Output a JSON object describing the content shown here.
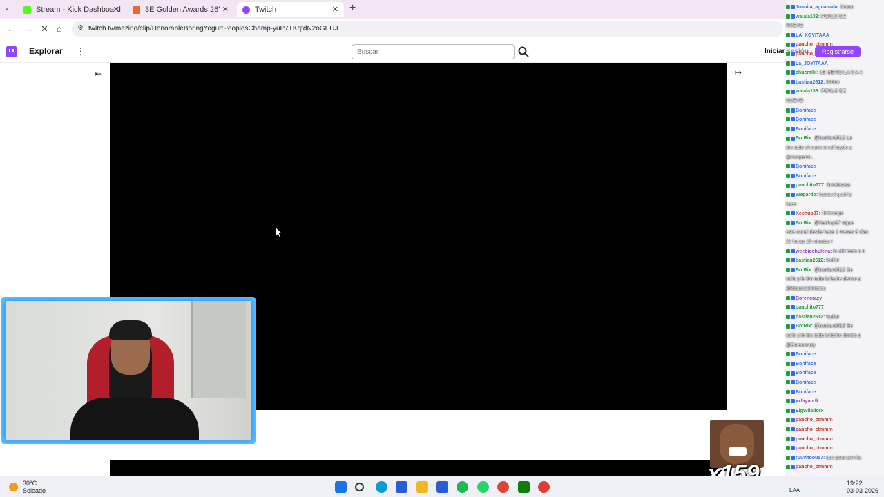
{
  "browser": {
    "tabs": [
      {
        "title": "Stream - Kick Dashboard",
        "favicon_color": "#53fc18",
        "active": false
      },
      {
        "title": "3E Golden Awards 26'",
        "favicon_color": "#f26522",
        "active": false
      },
      {
        "title": "Twitch",
        "favicon_color": "#9146ff",
        "active": true
      }
    ],
    "url": "twitch.tv/mazino/clip/HonorableBoringYogurtPeoplesChamp-yuP7TKqtdN2oGEUJ"
  },
  "twitch": {
    "explore_label": "Explorar",
    "search_placeholder": "Buscar",
    "login_label": "Iniciar sesión",
    "register_label": "Registrarse"
  },
  "chat": {
    "messages": [
      {
        "user": "Juanita_aguamala",
        "text": "!moco",
        "color": "#2b6cff"
      },
      {
        "user": "walala133",
        "text": "PONLO DE",
        "color": "#1f9e3d"
      },
      {
        "user": "",
        "text": "NUEVO",
        "color": "#000"
      },
      {
        "user": "LA_XOYITAAA",
        "text": "",
        "color": "#2b6cff"
      },
      {
        "user": "pancho_ctmmm",
        "text": "",
        "color": "#c0392b"
      },
      {
        "user": "pancho_ctmmm",
        "text": "",
        "color": "#c0392b"
      },
      {
        "user": "La_JOYITAAA",
        "text": "",
        "color": "#2b6cff"
      },
      {
        "user": "chucrallil",
        "text": "LE METIO LA R A 4",
        "color": "#1f9e3d"
      },
      {
        "user": "bastian2612",
        "text": "!moco",
        "color": "#2b6cff"
      },
      {
        "user": "walala133",
        "text": "PONLO DE",
        "color": "#1f9e3d"
      },
      {
        "user": "",
        "text": "NUEVO",
        "color": "#000"
      },
      {
        "user": "Boniface",
        "text": "",
        "color": "#2b6cff"
      },
      {
        "user": "Boniface",
        "text": "",
        "color": "#2b6cff"
      },
      {
        "user": "Boniface",
        "text": "",
        "color": "#2b6cff"
      },
      {
        "user": "BotRix",
        "text": "@bastian2612 Le",
        "color": "#1f9e3d"
      },
      {
        "user": "",
        "text": "tiro todo el moco en el hoyito a",
        "color": "#000"
      },
      {
        "user": "",
        "text": "@CasperCL",
        "color": "#000"
      },
      {
        "user": "Boniface",
        "text": "",
        "color": "#2b6cff"
      },
      {
        "user": "Boniface",
        "text": "",
        "color": "#2b6cff"
      },
      {
        "user": "panchito777",
        "text": "fomelawea",
        "color": "#1f9e3d"
      },
      {
        "user": "Wegardo",
        "text": "hasta el gotti la",
        "color": "#1f9e3d"
      },
      {
        "user": "",
        "text": "hace",
        "color": "#000"
      },
      {
        "user": "Kechup87",
        "text": "!followage",
        "color": "#c0392b"
      },
      {
        "user": "BotRix",
        "text": "@Kechup87 sigue",
        "color": "#1f9e3d"
      },
      {
        "user": "",
        "text": "este canal desde hace 1 meses 9 dias",
        "color": "#000"
      },
      {
        "user": "",
        "text": "21 horas 15 minutos !",
        "color": "#000"
      },
      {
        "user": "weebicohulena",
        "text": "la ulti freno a 3",
        "color": "#8e44ad"
      },
      {
        "user": "bastian2612",
        "text": "!culiar",
        "color": "#1f9e3d"
      },
      {
        "user": "BotRix",
        "text": "@bastian2612 Se",
        "color": "#1f9e3d"
      },
      {
        "user": "",
        "text": "culio y le tiro toda la leche dentro a",
        "color": "#000"
      },
      {
        "user": "",
        "text": "@kizaso1234secu",
        "color": "#000"
      },
      {
        "user": "Borencrazy",
        "text": "",
        "color": "#8e44ad"
      },
      {
        "user": "panchito777",
        "text": "",
        "color": "#1f9e3d"
      },
      {
        "user": "bastian2612",
        "text": "!culiar",
        "color": "#1f9e3d"
      },
      {
        "user": "BotRix",
        "text": "@bastian2612 Se",
        "color": "#1f9e3d"
      },
      {
        "user": "",
        "text": "culio y le tiro toda la leche dentro a",
        "color": "#000"
      },
      {
        "user": "",
        "text": "@Borencrazy",
        "color": "#000"
      },
      {
        "user": "Boniface",
        "text": "",
        "color": "#2b6cff"
      },
      {
        "user": "Boniface",
        "text": "",
        "color": "#2b6cff"
      },
      {
        "user": "Boniface",
        "text": "",
        "color": "#2b6cff"
      },
      {
        "user": "Boniface",
        "text": "",
        "color": "#2b6cff"
      },
      {
        "user": "Boniface",
        "text": "",
        "color": "#2b6cff"
      },
      {
        "user": "xxlayandk",
        "text": "",
        "color": "#8e44ad"
      },
      {
        "user": "ElgWiladorx",
        "text": "",
        "color": "#1f9e3d"
      },
      {
        "user": "pancho_ctmmm",
        "text": "",
        "color": "#c0392b"
      },
      {
        "user": "pancho_ctmmm",
        "text": "",
        "color": "#c0392b"
      },
      {
        "user": "pancho_ctmmm",
        "text": "",
        "color": "#c0392b"
      },
      {
        "user": "pancho_ctmmm",
        "text": "",
        "color": "#c0392b"
      },
      {
        "user": "ruuvitoou57",
        "text": "que pasa perrita",
        "color": "#2b6cff"
      },
      {
        "user": "pancho_ctmmm",
        "text": "",
        "color": "#c0392b"
      }
    ]
  },
  "emote_combo": "x159",
  "taskbar": {
    "weather_temp": "30°C",
    "weather_desc": "Soleado",
    "lang": "LAA",
    "time": "19:22",
    "date": "03-03-2026",
    "apps": [
      {
        "name": "windows-start-icon",
        "color": "#1a73e8"
      },
      {
        "name": "search-icon",
        "color": "#333333"
      },
      {
        "name": "edge-icon",
        "color": "#0f9ad6"
      },
      {
        "name": "store-icon",
        "color": "#2a5bd7"
      },
      {
        "name": "folder-icon",
        "color": "#f2b824"
      },
      {
        "name": "clipboard-icon",
        "color": "#2d5bd3"
      },
      {
        "name": "spotify-icon",
        "color": "#1db954"
      },
      {
        "name": "whatsapp-icon",
        "color": "#25d366"
      },
      {
        "name": "chrome-icon",
        "color": "#db4437"
      },
      {
        "name": "xbox-icon",
        "color": "#107c10"
      },
      {
        "name": "recorder-icon",
        "color": "#e53935"
      }
    ]
  }
}
